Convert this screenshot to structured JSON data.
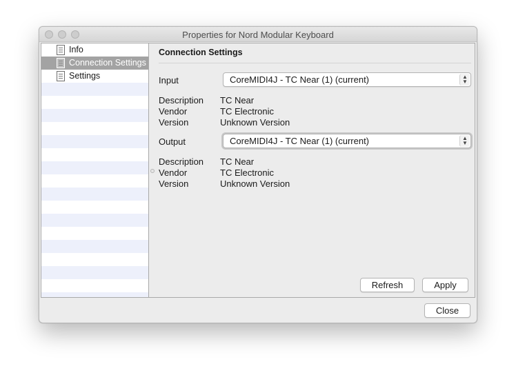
{
  "window": {
    "title": "Properties for Nord Modular Keyboard"
  },
  "sidebar": {
    "items": [
      {
        "label": "Info",
        "icon": "document-icon"
      },
      {
        "label": "Connection Settings",
        "icon": "document-icon",
        "selected": true
      },
      {
        "label": "Settings",
        "icon": "document-icon"
      }
    ]
  },
  "panel": {
    "title": "Connection Settings",
    "input": {
      "label": "Input",
      "selected": "CoreMIDI4J - TC Near (1) (current)",
      "description_label": "Description",
      "description": "TC Near",
      "vendor_label": "Vendor",
      "vendor": "TC Electronic",
      "version_label": "Version",
      "version": "Unknown Version"
    },
    "output": {
      "label": "Output",
      "selected": "CoreMIDI4J - TC Near (1) (current)",
      "description_label": "Description",
      "description": "TC Near",
      "vendor_label": "Vendor",
      "vendor": "TC Electronic",
      "version_label": "Version",
      "version": "Unknown Version"
    },
    "buttons": {
      "refresh": "Refresh",
      "apply": "Apply"
    }
  },
  "footer": {
    "close": "Close"
  },
  "colors": {
    "window_bg": "#ececec",
    "selected_row": "#a3a3a3",
    "alt_row": "#edf0fb"
  }
}
